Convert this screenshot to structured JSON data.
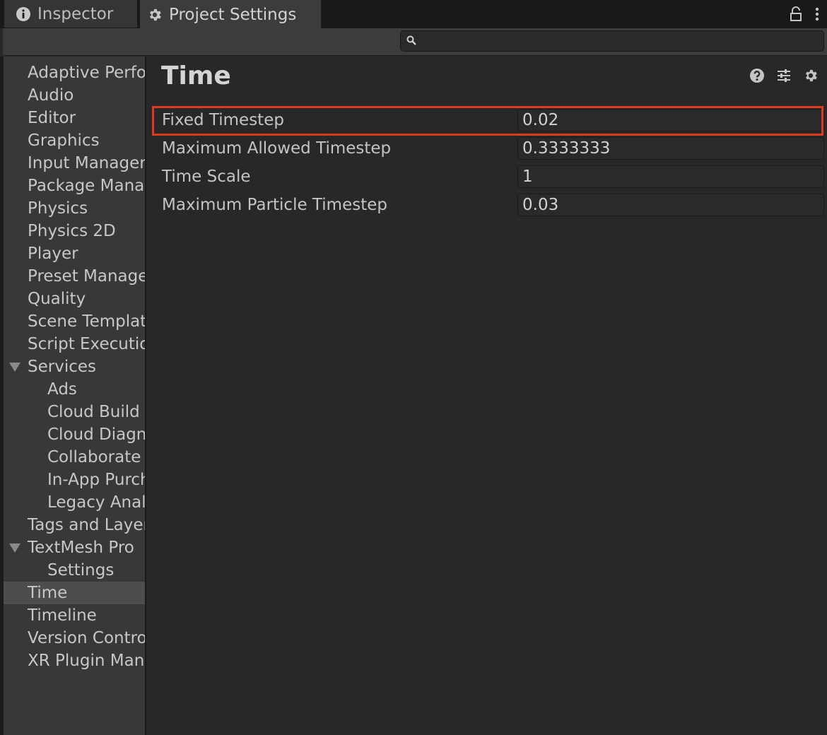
{
  "tabs": [
    {
      "label": "Inspector",
      "icon": "info-icon"
    },
    {
      "label": "Project Settings",
      "icon": "gear-icon"
    }
  ],
  "tab_controls": [
    "lock-icon",
    "more-vertical-icon"
  ],
  "search": {
    "placeholder": "",
    "value": ""
  },
  "sidebar": {
    "items": [
      {
        "label": "Adaptive Performance",
        "indent": 0
      },
      {
        "label": "Audio",
        "indent": 0
      },
      {
        "label": "Editor",
        "indent": 0
      },
      {
        "label": "Graphics",
        "indent": 0
      },
      {
        "label": "Input Manager",
        "indent": 0
      },
      {
        "label": "Package Manager",
        "indent": 0
      },
      {
        "label": "Physics",
        "indent": 0
      },
      {
        "label": "Physics 2D",
        "indent": 0
      },
      {
        "label": "Player",
        "indent": 0
      },
      {
        "label": "Preset Manager",
        "indent": 0
      },
      {
        "label": "Quality",
        "indent": 0
      },
      {
        "label": "Scene Template",
        "indent": 0
      },
      {
        "label": "Script Execution",
        "indent": 0
      },
      {
        "label": "Services",
        "indent": 0,
        "expanded": true
      },
      {
        "label": "Ads",
        "indent": 1
      },
      {
        "label": "Cloud Build",
        "indent": 1
      },
      {
        "label": "Cloud Diagnostics",
        "indent": 1
      },
      {
        "label": "Collaborate",
        "indent": 1
      },
      {
        "label": "In-App Purchasing",
        "indent": 1
      },
      {
        "label": "Legacy Analytics",
        "indent": 1
      },
      {
        "label": "Tags and Layers",
        "indent": 0
      },
      {
        "label": "TextMesh Pro",
        "indent": 0,
        "expanded": true
      },
      {
        "label": "Settings",
        "indent": 1
      },
      {
        "label": "Time",
        "indent": 0,
        "selected": true
      },
      {
        "label": "Timeline",
        "indent": 0
      },
      {
        "label": "Version Control",
        "indent": 0
      },
      {
        "label": "XR Plugin Management",
        "indent": 0
      }
    ]
  },
  "main": {
    "title": "Time",
    "header_icons": [
      "help-icon",
      "preset-sliders-icon",
      "settings-gear-icon"
    ],
    "fields": [
      {
        "label": "Fixed Timestep",
        "value": "0.02",
        "highlighted": true
      },
      {
        "label": "Maximum Allowed Timestep",
        "value": "0.3333333"
      },
      {
        "label": "Time Scale",
        "value": "1"
      },
      {
        "label": "Maximum Particle Timestep",
        "value": "0.03"
      }
    ]
  },
  "colors": {
    "highlight_border": "#e03a1e",
    "selected_item_bg": "#4d4d4d",
    "panel_bg": "#282828",
    "sidebar_bg": "#383838"
  }
}
